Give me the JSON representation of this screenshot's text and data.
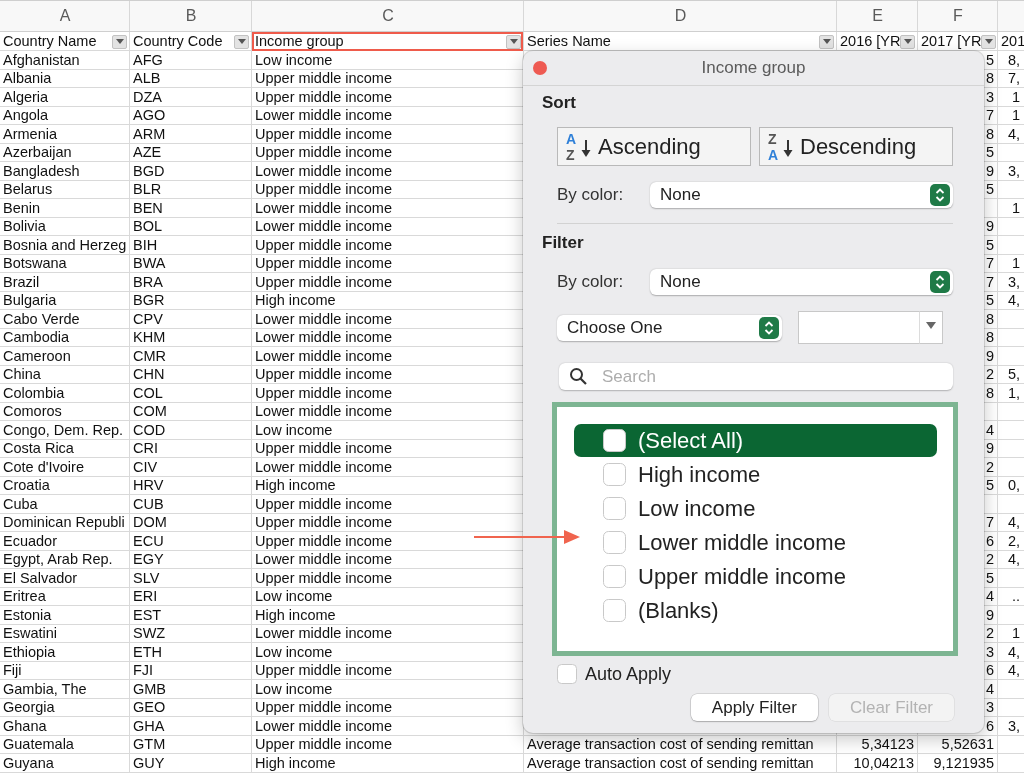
{
  "sheet": {
    "column_letters": [
      "A",
      "B",
      "C",
      "D",
      "E",
      "F"
    ],
    "headers": [
      {
        "label": "Country Name",
        "filter_button": true,
        "highlighted": false
      },
      {
        "label": "Country Code",
        "filter_button": true,
        "highlighted": false
      },
      {
        "label": "Income group",
        "filter_button": true,
        "highlighted": true
      },
      {
        "label": "Series Name",
        "filter_button": true,
        "highlighted": false
      },
      {
        "label": "2016 [YR",
        "filter_button": true,
        "highlighted": false
      },
      {
        "label": "2017 [YR",
        "filter_button": true,
        "highlighted": false
      },
      {
        "label": "201",
        "filter_button": false,
        "highlighted": false
      }
    ],
    "rows": [
      {
        "country_name": "Afghanistan",
        "country_code": "AFG",
        "income_group": "Low income",
        "value_2017": "5",
        "column_g": "8,"
      },
      {
        "country_name": "Albania",
        "country_code": "ALB",
        "income_group": "Upper middle income",
        "value_2017": "8",
        "column_g": "7,"
      },
      {
        "country_name": "Algeria",
        "country_code": "DZA",
        "income_group": "Upper middle income",
        "value_2017": "3",
        "column_g": "1"
      },
      {
        "country_name": "Angola",
        "country_code": "AGO",
        "income_group": "Lower middle income",
        "value_2017": "7",
        "column_g": "1"
      },
      {
        "country_name": "Armenia",
        "country_code": "ARM",
        "income_group": "Upper middle income",
        "value_2017": "8",
        "column_g": "4,"
      },
      {
        "country_name": "Azerbaijan",
        "country_code": "AZE",
        "income_group": "Upper middle income",
        "value_2017": "5"
      },
      {
        "country_name": "Bangladesh",
        "country_code": "BGD",
        "income_group": "Lower middle income",
        "value_2017": "9",
        "column_g": "3,"
      },
      {
        "country_name": "Belarus",
        "country_code": "BLR",
        "income_group": "Upper middle income",
        "value_2017": "5"
      },
      {
        "country_name": "Benin",
        "country_code": "BEN",
        "income_group": "Lower middle income",
        "column_g": "1"
      },
      {
        "country_name": "Bolivia",
        "country_code": "BOL",
        "income_group": "Lower middle income",
        "value_2017": "9"
      },
      {
        "country_name": "Bosnia and Herzeg",
        "country_code": "BIH",
        "income_group": "Upper middle income",
        "value_2017": "5"
      },
      {
        "country_name": "Botswana",
        "country_code": "BWA",
        "income_group": "Upper middle income",
        "value_2017": "7",
        "column_g": "1"
      },
      {
        "country_name": "Brazil",
        "country_code": "BRA",
        "income_group": "Upper middle income",
        "value_2017": "7",
        "column_g": "3,"
      },
      {
        "country_name": "Bulgaria",
        "country_code": "BGR",
        "income_group": "High income",
        "value_2017": "5",
        "column_g": "4,"
      },
      {
        "country_name": "Cabo Verde",
        "country_code": "CPV",
        "income_group": "Lower middle income",
        "value_2017": "8"
      },
      {
        "country_name": "Cambodia",
        "country_code": "KHM",
        "income_group": "Lower middle income",
        "value_2017": "8"
      },
      {
        "country_name": "Cameroon",
        "country_code": "CMR",
        "income_group": "Lower middle income",
        "value_2017": "9"
      },
      {
        "country_name": "China",
        "country_code": "CHN",
        "income_group": "Upper middle income",
        "value_2017": "2",
        "column_g": "5,"
      },
      {
        "country_name": "Colombia",
        "country_code": "COL",
        "income_group": "Upper middle income",
        "value_2017": "8",
        "column_g": "1,"
      },
      {
        "country_name": "Comoros",
        "country_code": "COM",
        "income_group": "Lower middle income"
      },
      {
        "country_name": "Congo, Dem. Rep.",
        "country_code": "COD",
        "income_group": "Low income",
        "value_2017": "4"
      },
      {
        "country_name": "Costa Rica",
        "country_code": "CRI",
        "income_group": "Upper middle income",
        "value_2017": "9"
      },
      {
        "country_name": "Cote d'Ivoire",
        "country_code": "CIV",
        "income_group": "Lower middle income",
        "value_2017": "2"
      },
      {
        "country_name": "Croatia",
        "country_code": "HRV",
        "income_group": "High income",
        "value_2017": "5",
        "column_g": "0,"
      },
      {
        "country_name": "Cuba",
        "country_code": "CUB",
        "income_group": "Upper middle income"
      },
      {
        "country_name": "Dominican Republi",
        "country_code": "DOM",
        "income_group": "Upper middle income",
        "value_2017": "7",
        "column_g": "4,"
      },
      {
        "country_name": "Ecuador",
        "country_code": "ECU",
        "income_group": "Upper middle income",
        "value_2017": "6",
        "column_g": "2,"
      },
      {
        "country_name": "Egypt, Arab Rep.",
        "country_code": "EGY",
        "income_group": "Lower middle income",
        "value_2017": "2",
        "column_g": "4,"
      },
      {
        "country_name": "El Salvador",
        "country_code": "SLV",
        "income_group": "Upper middle income",
        "value_2017": "5"
      },
      {
        "country_name": "Eritrea",
        "country_code": "ERI",
        "income_group": "Low income",
        "value_2017": "4",
        "column_g": ".."
      },
      {
        "country_name": "Estonia",
        "country_code": "EST",
        "income_group": "High income",
        "value_2017": "9"
      },
      {
        "country_name": "Eswatini",
        "country_code": "SWZ",
        "income_group": "Lower middle income",
        "value_2017": "2",
        "column_g": "1"
      },
      {
        "country_name": "Ethiopia",
        "country_code": "ETH",
        "income_group": "Low income",
        "value_2017": "3",
        "column_g": "4,"
      },
      {
        "country_name": "Fiji",
        "country_code": "FJI",
        "income_group": "Upper middle income",
        "value_2017": "6",
        "column_g": "4,"
      },
      {
        "country_name": "Gambia, The",
        "country_code": "GMB",
        "income_group": "Low income",
        "value_2017": "4"
      },
      {
        "country_name": "Georgia",
        "country_code": "GEO",
        "income_group": "Upper middle income",
        "value_2017": "3"
      },
      {
        "country_name": "Ghana",
        "country_code": "GHA",
        "income_group": "Lower middle income",
        "value_2017": "6",
        "column_g": "3,"
      },
      {
        "country_name": "Guatemala",
        "country_code": "GTM",
        "income_group": "Upper middle income",
        "series_name": "Average transaction cost of sending remittan",
        "value_2016": "5,34123",
        "value_2017": "5,52631"
      },
      {
        "country_name": "Guyana",
        "country_code": "GUY",
        "income_group": "High income",
        "series_name": "Average transaction cost of sending remittan",
        "value_2016": "10,04213",
        "value_2017": "9,121935"
      }
    ]
  },
  "filter_popup": {
    "title": "Income group",
    "sort": {
      "heading": "Sort",
      "buttons": [
        {
          "kind": "ascending",
          "label": "Ascending",
          "icon_letters": [
            "A",
            "Z"
          ]
        },
        {
          "kind": "descending",
          "label": "Descending",
          "icon_letters": [
            "Z",
            "A"
          ]
        }
      ],
      "by_color": {
        "label": "By color:",
        "value": "None"
      }
    },
    "filter": {
      "heading": "Filter",
      "by_color": {
        "label": "By color:",
        "value": "None"
      },
      "condition": {
        "value": "Choose One"
      }
    },
    "search": {
      "placeholder": "Search"
    },
    "items": [
      {
        "label": "(Select All)",
        "checked": false,
        "selected": true,
        "arrow_marker": false
      },
      {
        "label": "High income",
        "checked": false,
        "selected": false,
        "arrow_marker": false
      },
      {
        "label": "Low income",
        "checked": false,
        "selected": false,
        "arrow_marker": false
      },
      {
        "label": "Lower middle income",
        "checked": false,
        "selected": false,
        "arrow_marker": true
      },
      {
        "label": "Upper middle income",
        "checked": false,
        "selected": false,
        "arrow_marker": false
      },
      {
        "label": "(Blanks)",
        "checked": false,
        "selected": false,
        "arrow_marker": false
      }
    ],
    "auto_apply": {
      "label": "Auto Apply",
      "checked": false
    },
    "buttons": [
      {
        "label": "Apply Filter",
        "disabled": false
      },
      {
        "label": "Clear Filter",
        "disabled": true
      }
    ]
  }
}
